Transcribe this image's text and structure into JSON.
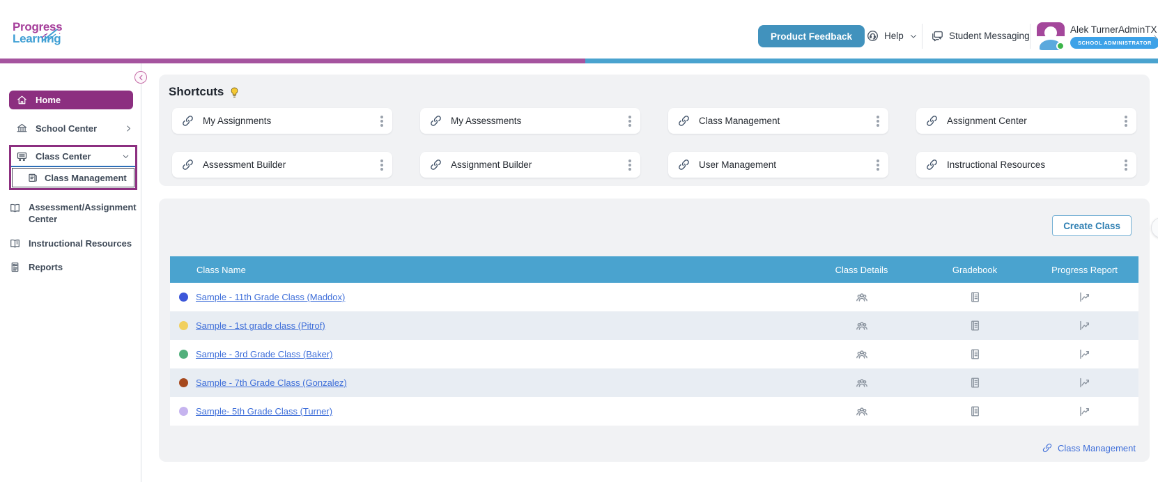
{
  "brand": {
    "name_line1": "Progress",
    "name_line2": "Learning",
    "magenta": "#a63f9b",
    "blue": "#3f9fd4"
  },
  "header": {
    "product_feedback": "Product Feedback",
    "help": "Help",
    "student_messaging": "Student Messaging",
    "user_name": "Alek TurnerAdminTX",
    "user_role": "SCHOOL ADMINISTRATOR"
  },
  "accent_bars": {
    "left_color": "#a5549f",
    "right_color": "#4aa3cf"
  },
  "sidebar": {
    "home": "Home",
    "school_center": "School Center",
    "class_center": "Class Center",
    "class_management": "Class Management",
    "assessment_assignment_center": "Assessment/Assignment Center",
    "instructional_resources": "Instructional Resources",
    "reports": "Reports",
    "active_item": "Home",
    "active_color": "#8c2f80"
  },
  "shortcuts": {
    "title": "Shortcuts",
    "cards": [
      {
        "label": "My Assignments"
      },
      {
        "label": "My Assessments"
      },
      {
        "label": "Class Management"
      },
      {
        "label": "Assignment Center"
      },
      {
        "label": "Assessment Builder"
      },
      {
        "label": "Assignment Builder"
      },
      {
        "label": "User Management"
      },
      {
        "label": "Instructional Resources"
      }
    ]
  },
  "classes": {
    "create_class": "Create Class",
    "columns": {
      "name": "Class Name",
      "details": "Class Details",
      "gradebook": "Gradebook",
      "progress": "Progress Report"
    },
    "header_color": "#4aa3cf",
    "rows": [
      {
        "name": "Sample - 11th Grade Class (Maddox)",
        "dot": "#3c57d9"
      },
      {
        "name": "Sample - 1st grade class (Pitrof)",
        "dot": "#f1d05e"
      },
      {
        "name": "Sample - 3rd Grade Class (Baker)",
        "dot": "#52b07c"
      },
      {
        "name": "Sample - 7th Grade Class (Gonzalez)",
        "dot": "#a6491e"
      },
      {
        "name": "Sample- 5th Grade Class (Turner)",
        "dot": "#c6b4ef"
      }
    ],
    "footer_link": "Class Management"
  },
  "icons": {
    "help": "headset-circle",
    "student_messaging": "chat-bubbles",
    "shortcut": "link-chain",
    "card_menu": "kebab-vertical",
    "shortcuts_title": "lightbulb",
    "class_details": "people-group",
    "gradebook": "notebook",
    "progress_report": "line-chart",
    "sidebar_collapse": "arrow-left-circle"
  }
}
